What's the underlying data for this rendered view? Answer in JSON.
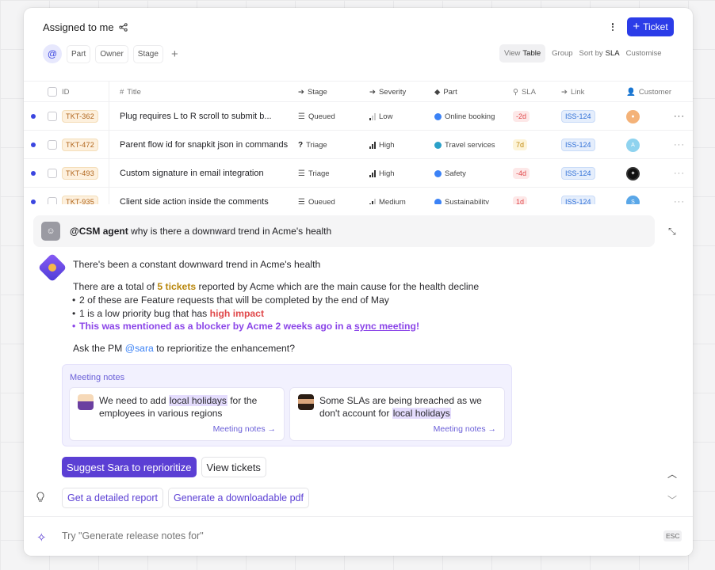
{
  "header": {
    "title": "Assigned to me",
    "ticket_button": "Ticket",
    "filters": [
      "Part",
      "Owner",
      "Stage"
    ],
    "view_label": "View",
    "view_value": "Table",
    "group_label": "Group",
    "sort_label": "Sort by",
    "sort_value": "SLA",
    "customise_label": "Customise"
  },
  "table": {
    "columns": {
      "id": "ID",
      "title": "Title",
      "stage": "Stage",
      "severity": "Severity",
      "part": "Part",
      "sla": "SLA",
      "link": "Link",
      "customer": "Customer"
    },
    "rows": [
      {
        "id": "TKT-362",
        "title": "Plug requires L to R scroll to submit b...",
        "stage": "Queued",
        "severity": "Low",
        "severity_level": 1,
        "part": "Online booking",
        "sla": "-2d",
        "sla_color": "#e0484a",
        "link": "ISS-124",
        "customer_color": "#f4b278"
      },
      {
        "id": "TKT-472",
        "title": "Parent flow id for snapkit json in commands",
        "stage": "Triage",
        "severity": "High",
        "severity_level": 3,
        "part": "Travel services",
        "sla": "7d",
        "sla_color": "#c08a10",
        "link": "ISS-124",
        "customer_color": "#8fd3ef"
      },
      {
        "id": "TKT-493",
        "title": "Custom signature in email integration",
        "stage": "Triage",
        "severity": "High",
        "severity_level": 3,
        "part": "Safety",
        "sla": "-4d",
        "sla_color": "#e0484a",
        "link": "ISS-124",
        "customer_color": "#111111"
      },
      {
        "id": "TKT-935",
        "title": "Client side action inside the comments",
        "stage": "Queued",
        "severity": "Medium",
        "severity_level": 2,
        "part": "Sustainability",
        "sla": "1d",
        "sla_color": "#e0484a",
        "link": "ISS-124",
        "customer_color": "#5aa7e8"
      }
    ]
  },
  "chat": {
    "agent_mention": "@CSM agent",
    "question": "why is there a downward trend in Acme's health",
    "answer_intro": "There's been a constant downward trend in Acme's health",
    "answer_total_pre": "There are a total of ",
    "answer_total_hl": "5 tickets",
    "answer_total_post": " reported by Acme which are the main cause for the health decline",
    "bullet1": "2 of these are Feature requests that will be completed by the end of May",
    "bullet2_pre": "1 is a low priority bug that has ",
    "bullet2_hl": "high impact",
    "bullet3_pre": "This was mentioned as a blocker by Acme 2 weeks ago in a ",
    "bullet3_link": "sync meeting",
    "bullet3_post": "!",
    "ask_pre": "Ask the PM ",
    "ask_mention": "@sara",
    "ask_post": " to reprioritize the enhancement?",
    "notes_title": "Meeting notes",
    "note1_pre": "We need to add ",
    "note1_hl": "local holidays",
    "note1_post": " for the employees in various regions",
    "note2_pre": "Some SLAs are being breached as we don't account for ",
    "note2_hl": "local holidays",
    "note_link": "Meeting notes →",
    "action_primary": "Suggest Sara to reprioritize",
    "action_secondary": "View tickets",
    "suggestion1": "Get a detailed report",
    "suggestion2": "Generate a downloadable pdf",
    "input_placeholder": "Try \"Generate release notes for\"",
    "esc_label": "ESC"
  },
  "colors": {
    "accent": "#2b3ce8",
    "primary_action": "#5b3fd4",
    "unread_dot": "#3b46e0"
  }
}
